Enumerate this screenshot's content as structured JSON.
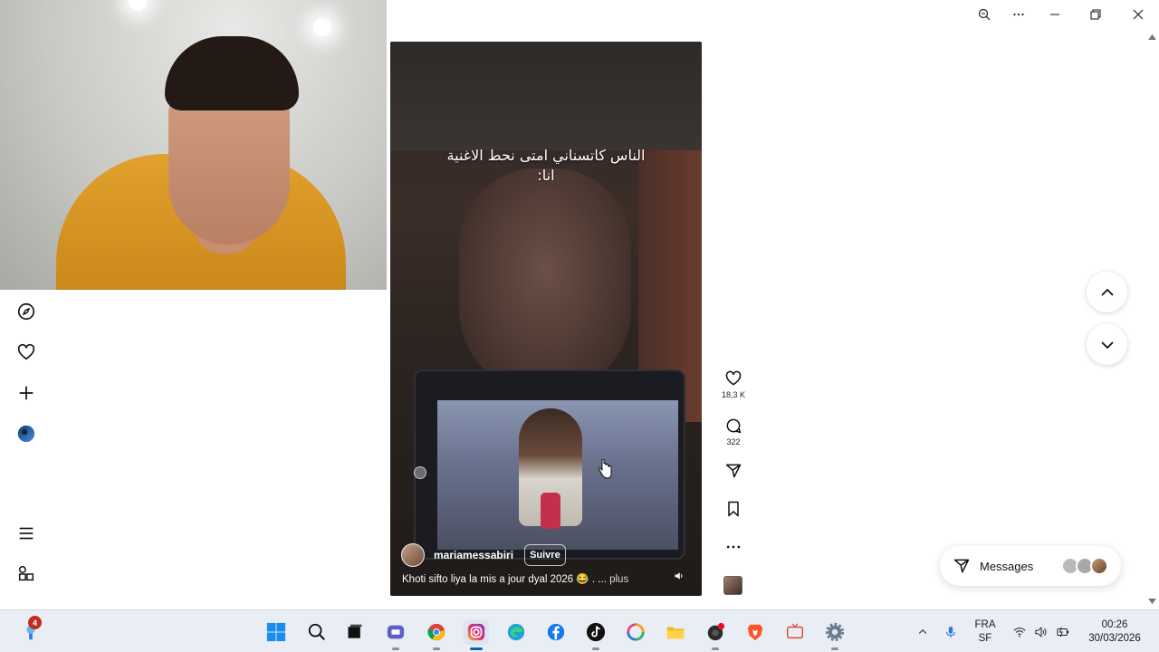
{
  "window": {
    "controls": [
      "zoom-icon",
      "more-icon",
      "minimize-icon",
      "restore-icon",
      "close-icon"
    ]
  },
  "sidebar": {
    "items": [
      {
        "name": "explore",
        "icon": "compass-icon"
      },
      {
        "name": "notifications",
        "icon": "heart-icon"
      },
      {
        "name": "create",
        "icon": "plus-icon"
      },
      {
        "name": "profile",
        "icon": "avatar"
      },
      {
        "name": "more",
        "icon": "menu-icon"
      },
      {
        "name": "also-from-meta",
        "icon": "apps-icon"
      }
    ]
  },
  "reel": {
    "overlay_line1": "الناس كاتسناني امتى نحط الاغنية",
    "overlay_line2": "انا:",
    "username": "mariamessabiri",
    "follow_label": "Suivre",
    "caption": "Khoti sifto liya la mis a jour dyal 2026 😂 . ...",
    "more_label": "plus"
  },
  "actions": {
    "likes": "18,3 K",
    "comments": "322"
  },
  "messages": {
    "label": "Messages"
  },
  "taskbar": {
    "notification_count": "4",
    "apps": [
      "start",
      "search",
      "file-explorer-dark",
      "teams",
      "chrome",
      "instagram",
      "edge",
      "facebook",
      "tiktok",
      "photos",
      "folder",
      "recorder",
      "brave",
      "media",
      "settings"
    ],
    "language_line1": "FRA",
    "language_line2": "SF",
    "time": "00:26",
    "date": "30/03/2026"
  },
  "colors": {
    "instagram_accent": "#0067c0",
    "badge_red": "#c42b1c",
    "taskbar_bg": "#e9eef4"
  }
}
